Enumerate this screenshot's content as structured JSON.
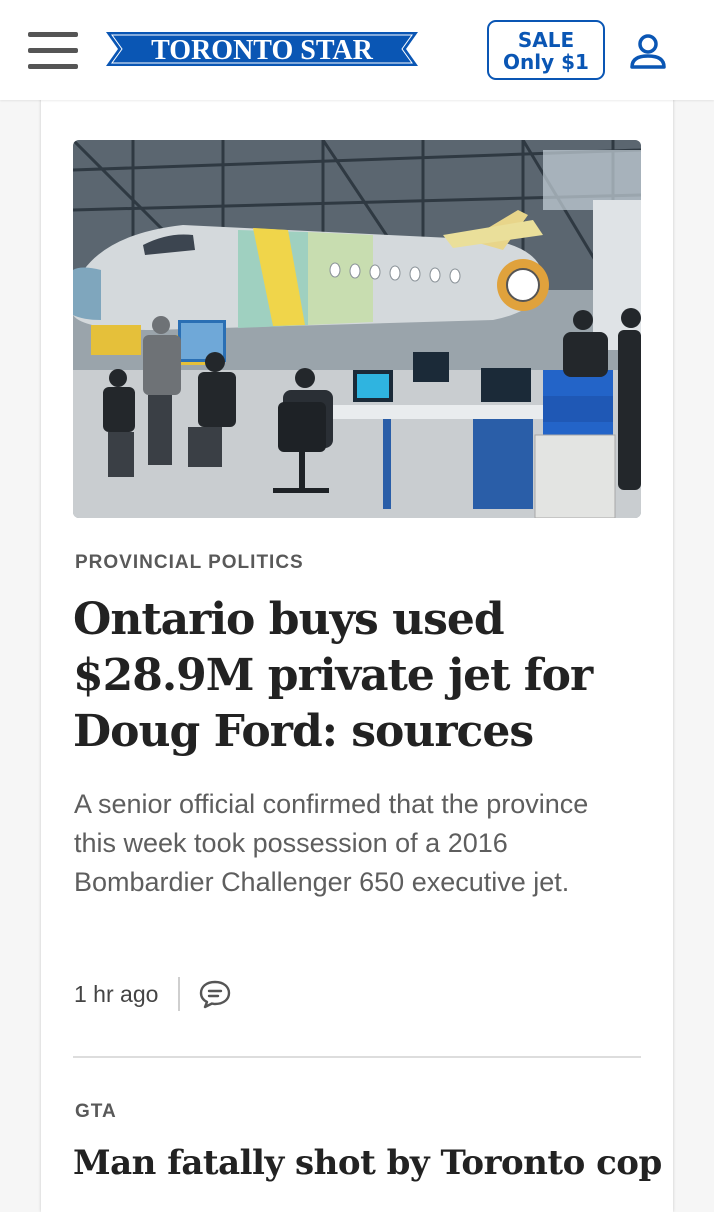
{
  "header": {
    "menu_icon": "hamburger-menu-icon",
    "logo_text": "TORONTO STAR",
    "sale_line1": "SALE",
    "sale_line2": "Only $1",
    "account_icon": "user-account-icon",
    "brand_color": "#0a56b4"
  },
  "articles": [
    {
      "kicker": "PROVINCIAL POLITICS",
      "headline": "Ontario buys used $28.9M private jet for Doug Ford: sources",
      "summary": "A senior official confirmed that the province this week took possession of a 2016 Bombardier Challenger 650 executive jet.",
      "timestamp": "1 hr ago",
      "comment_icon": "comment-bubble-icon"
    },
    {
      "kicker": "GTA",
      "headline": "Man fatally shot by Toronto cop"
    }
  ]
}
